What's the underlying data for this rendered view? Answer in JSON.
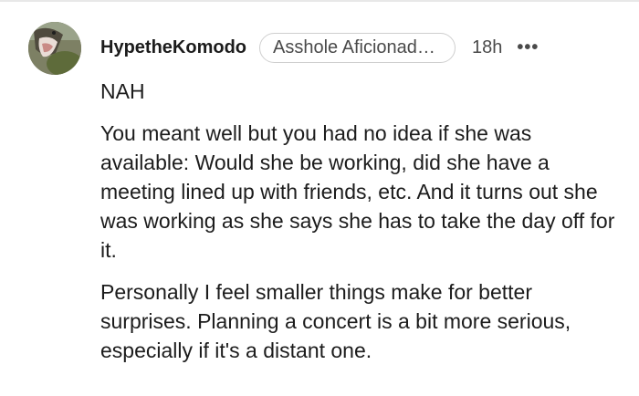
{
  "comment": {
    "username": "HypetheKomodo",
    "flair": "Asshole Aficionado [...",
    "timestamp": "18h",
    "more_label": "•••",
    "verdict": "NAH",
    "paragraph_1": "You meant well but you had no idea if she was available: Would she be working, did she have a meeting lined up with friends, etc. And it turns out she was working as she says she has to take the day off for it.",
    "paragraph_2": "Personally I feel smaller things make for better surprises. Planning a concert is a bit more serious, especially if it's a distant one."
  },
  "colors": {
    "text": "#1c1c1c",
    "meta": "#4a4a4a",
    "flair_border": "#cfcfcf",
    "background": "#ffffff"
  },
  "icons": {
    "avatar": "komodo-avatar-photo",
    "more": "more-options-icon"
  }
}
